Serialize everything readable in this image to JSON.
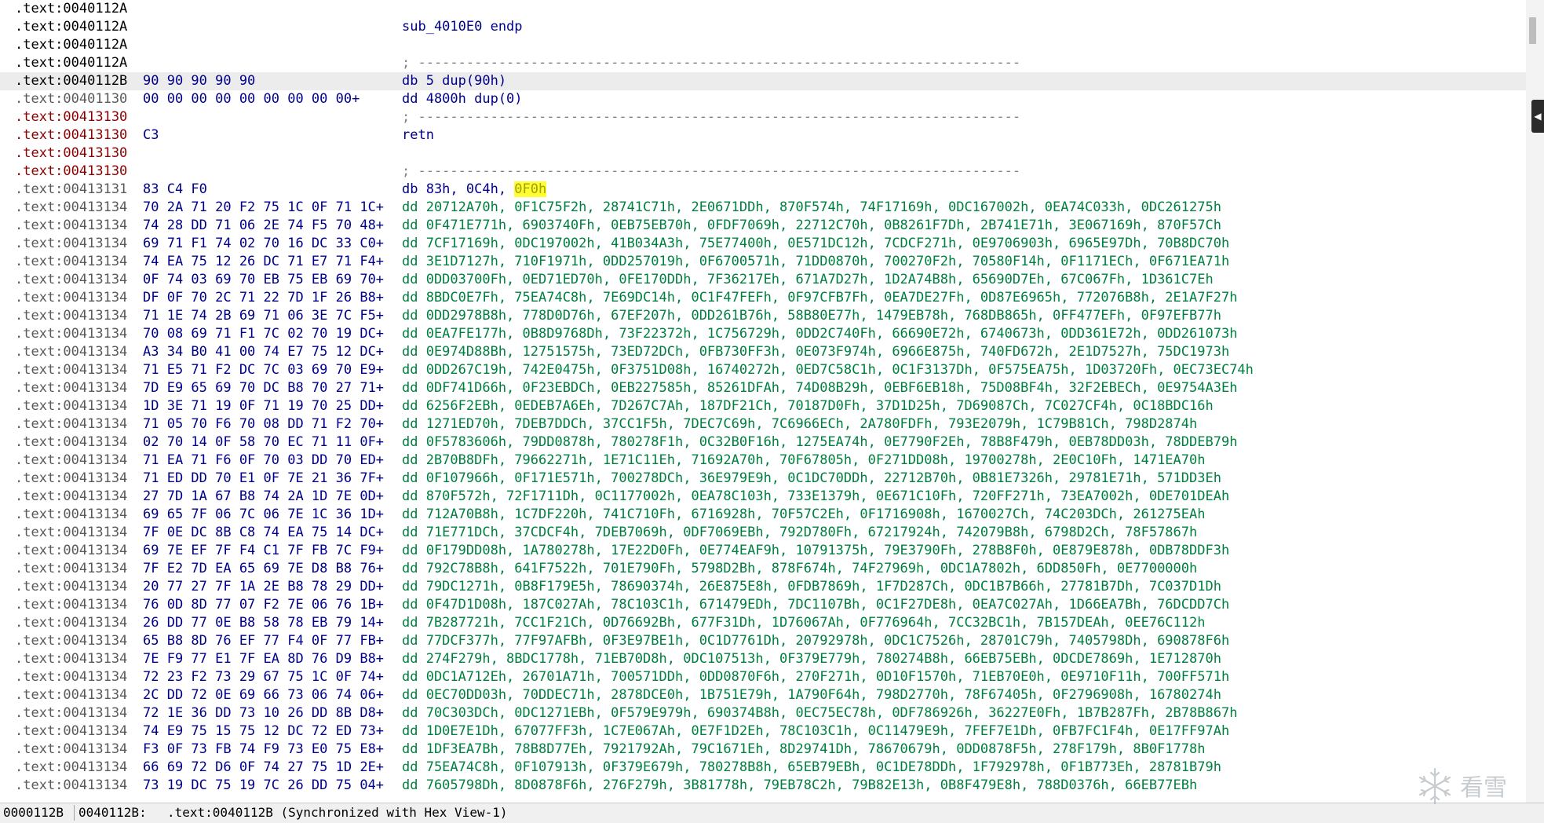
{
  "disassembly": {
    "lines": [
      {
        "addr": ".text:0040112A",
        "addr_style": "black",
        "bytes": "",
        "code": "",
        "code_style": ""
      },
      {
        "addr": ".text:0040112A",
        "addr_style": "black",
        "bytes": "",
        "code": "sub_4010E0 endp",
        "code_style": ""
      },
      {
        "addr": ".text:0040112A",
        "addr_style": "black",
        "bytes": "",
        "code": "",
        "code_style": ""
      },
      {
        "addr": ".text:0040112A",
        "addr_style": "black",
        "bytes": "",
        "code": "; ---------------------------------------------------------------------------",
        "code_style": "sep"
      },
      {
        "addr": ".text:0040112B",
        "addr_style": "black",
        "bytes": "90 90 90 90 90",
        "code": "db 5 dup(90h)",
        "code_style": "",
        "highlight": true
      },
      {
        "addr": ".text:00401130",
        "addr_style": "gray",
        "bytes": "00 00 00 00 00 00 00 00 00+",
        "code": "dd 4800h dup(0)",
        "code_style": ""
      },
      {
        "addr": ".text:00413130",
        "addr_style": "red",
        "bytes": "",
        "code": "; ---------------------------------------------------------------------------",
        "code_style": "sep"
      },
      {
        "addr": ".text:00413130",
        "addr_style": "red",
        "bytes": "C3",
        "code": "retn",
        "code_style": ""
      },
      {
        "addr": ".text:00413130",
        "addr_style": "red",
        "bytes": "",
        "code": "",
        "code_style": ""
      },
      {
        "addr": ".text:00413130",
        "addr_style": "red",
        "bytes": "",
        "code": "; ---------------------------------------------------------------------------",
        "code_style": "sep"
      },
      {
        "addr": ".text:00413131",
        "addr_style": "gray",
        "bytes": "83 C4 F0",
        "code": "db 83h, 0C4h, ",
        "code_style": "",
        "code_hl": "0F0h"
      },
      {
        "addr": ".text:00413134",
        "addr_style": "gray",
        "bytes": "70 2A 71 20 F2 75 1C 0F 71 1C+",
        "code": "dd 20712A70h, 0F1C75F2h, 28741C71h, 2E0671DDh, 870F574h, 74F17169h, 0DC167002h, 0EA74C033h, 0DC261275h",
        "code_style": "data"
      },
      {
        "addr": ".text:00413134",
        "addr_style": "gray",
        "bytes": "74 28 DD 71 06 2E 74 F5 70 48+",
        "code": "dd 0F471E771h, 6903740Fh, 0EB75EB70h, 0FDF7069h, 22712C70h, 0B8261F7Dh, 2B741E71h, 3E067169h, 870F57Ch",
        "code_style": "data"
      },
      {
        "addr": ".text:00413134",
        "addr_style": "gray",
        "bytes": "69 71 F1 74 02 70 16 DC 33 C0+",
        "code": "dd 7CF17169h, 0DC197002h, 41B034A3h, 75E77400h, 0E571DC12h, 7CDCF271h, 0E9706903h, 6965E97Dh, 70B8DC70h",
        "code_style": "data"
      },
      {
        "addr": ".text:00413134",
        "addr_style": "gray",
        "bytes": "74 EA 75 12 26 DC 71 E7 71 F4+",
        "code": "dd 3E1D7127h, 710F1971h, 0DD257019h, 0F6700571h, 71DD0870h, 700270F2h, 70580F14h, 0F1171ECh, 0F671EA71h",
        "code_style": "data"
      },
      {
        "addr": ".text:00413134",
        "addr_style": "gray",
        "bytes": "0F 74 03 69 70 EB 75 EB 69 70+",
        "code": "dd 0DD03700Fh, 0ED71ED70h, 0FE170DDh, 7F36217Eh, 671A7D27h, 1D2A74B8h, 65690D7Eh, 67C067Fh, 1D361C7Eh",
        "code_style": "data"
      },
      {
        "addr": ".text:00413134",
        "addr_style": "gray",
        "bytes": "DF 0F 70 2C 71 22 7D 1F 26 B8+",
        "code": "dd 8BDC0E7Fh, 75EA74C8h, 7E69DC14h, 0C1F47FEFh, 0F97CFB7Fh, 0EA7DE27Fh, 0D87E6965h, 772076B8h, 2E1A7F27h",
        "code_style": "data"
      },
      {
        "addr": ".text:00413134",
        "addr_style": "gray",
        "bytes": "71 1E 74 2B 69 71 06 3E 7C F5+",
        "code": "dd 0DD2978B8h, 778D0D76h, 67EF207h, 0DD261B76h, 58B80E77h, 1479EB78h, 768DB865h, 0FF477EFh, 0F97EFB77h",
        "code_style": "data"
      },
      {
        "addr": ".text:00413134",
        "addr_style": "gray",
        "bytes": "70 08 69 71 F1 7C 02 70 19 DC+",
        "code": "dd 0EA7FE177h, 0B8D9768Dh, 73F22372h, 1C756729h, 0DD2C740Fh, 66690E72h, 6740673h, 0DD361E72h, 0DD261073h",
        "code_style": "data"
      },
      {
        "addr": ".text:00413134",
        "addr_style": "gray",
        "bytes": "A3 34 B0 41 00 74 E7 75 12 DC+",
        "code": "dd 0E974D88Bh, 12751575h, 73ED72DCh, 0FB730FF3h, 0E073F974h, 6966E875h, 740FD672h, 2E1D7527h, 75DC1973h",
        "code_style": "data"
      },
      {
        "addr": ".text:00413134",
        "addr_style": "gray",
        "bytes": "71 E5 71 F2 DC 7C 03 69 70 E9+",
        "code": "dd 0DD267C19h, 742E0475h, 0F3751D08h, 16740272h, 0ED7C58C1h, 0C1F3137Dh, 0F575EA75h, 1D03720Fh, 0EC73EC74h",
        "code_style": "data"
      },
      {
        "addr": ".text:00413134",
        "addr_style": "gray",
        "bytes": "7D E9 65 69 70 DC B8 70 27 71+",
        "code": "dd 0DF741D66h, 0F23EBDCh, 0EB227585h, 85261DFAh, 74D08B29h, 0EBF6EB18h, 75D08BF4h, 32F2EBECh, 0E9754A3Eh",
        "code_style": "data"
      },
      {
        "addr": ".text:00413134",
        "addr_style": "gray",
        "bytes": "1D 3E 71 19 0F 71 19 70 25 DD+",
        "code": "dd 6256F2EBh, 0EDEB7A6Eh, 7D267C7Ah, 187DF21Ch, 70187D0Fh, 37D1D25h, 7D69087Ch, 7C027CF4h, 0C18BDC16h",
        "code_style": "data"
      },
      {
        "addr": ".text:00413134",
        "addr_style": "gray",
        "bytes": "71 05 70 F6 70 08 DD 71 F2 70+",
        "code": "dd 1271ED70h, 7DEB7DDCh, 37CC1F5h, 7DEC7C69h, 7C6966ECh, 2A780FDFh, 793E2079h, 1C79B81Ch, 798D2874h",
        "code_style": "data"
      },
      {
        "addr": ".text:00413134",
        "addr_style": "gray",
        "bytes": "02 70 14 0F 58 70 EC 71 11 0F+",
        "code": "dd 0F5783606h, 79DD0878h, 780278F1h, 0C32B0F16h, 1275EA74h, 0E7790F2Eh, 78B8F479h, 0EB78DD03h, 78DDEB79h",
        "code_style": "data"
      },
      {
        "addr": ".text:00413134",
        "addr_style": "gray",
        "bytes": "71 EA 71 F6 0F 70 03 DD 70 ED+",
        "code": "dd 2B70B8DFh, 79662271h, 1E71C11Eh, 71692A70h, 70F67805h, 0F271DD08h, 19700278h, 2E0C10Fh, 1471EA70h",
        "code_style": "data"
      },
      {
        "addr": ".text:00413134",
        "addr_style": "gray",
        "bytes": "71 ED DD 70 E1 0F 7E 21 36 7F+",
        "code": "dd 0F107966h, 0F171E571h, 700278DCh, 36E979E9h, 0C1DC70DDh, 22712B70h, 0B81E7326h, 29781E71h, 571DD3Eh",
        "code_style": "data"
      },
      {
        "addr": ".text:00413134",
        "addr_style": "gray",
        "bytes": "27 7D 1A 67 B8 74 2A 1D 7E 0D+",
        "code": "dd 870F572h, 72F1711Dh, 0C1177002h, 0EA78C103h, 733E1379h, 0E671C10Fh, 720FF271h, 73EA7002h, 0DE701DEAh",
        "code_style": "data"
      },
      {
        "addr": ".text:00413134",
        "addr_style": "gray",
        "bytes": "69 65 7F 06 7C 06 7E 1C 36 1D+",
        "code": "dd 712A70B8h, 1C7DF220h, 741C710Fh, 6716928h, 70F57C2Eh, 0F1716908h, 1670027Ch, 74C203DCh, 261275EAh",
        "code_style": "data"
      },
      {
        "addr": ".text:00413134",
        "addr_style": "gray",
        "bytes": "7F 0E DC 8B C8 74 EA 75 14 DC+",
        "code": "dd 71E771DCh, 37CDCF4h, 7DEB7069h, 0DF7069EBh, 792D780Fh, 67217924h, 742079B8h, 6798D2Ch, 78F57867h",
        "code_style": "data"
      },
      {
        "addr": ".text:00413134",
        "addr_style": "gray",
        "bytes": "69 7E EF 7F F4 C1 7F FB 7C F9+",
        "code": "dd 0F179DD08h, 1A780278h, 17E22D0Fh, 0E774EAF9h, 10791375h, 79E3790Fh, 278B8F0h, 0E879E878h, 0DB78DDF3h",
        "code_style": "data"
      },
      {
        "addr": ".text:00413134",
        "addr_style": "gray",
        "bytes": "7F E2 7D EA 65 69 7E D8 B8 76+",
        "code": "dd 792C78B8h, 641F7522h, 701E790Fh, 5798D2Bh, 878F674h, 74F27969h, 0DC1A7802h, 6DD850Fh, 0E7700000h",
        "code_style": "data"
      },
      {
        "addr": ".text:00413134",
        "addr_style": "gray",
        "bytes": "20 77 27 7F 1A 2E B8 78 29 DD+",
        "code": "dd 79DC1271h, 0B8F179E5h, 78690374h, 26E875E8h, 0FDB7869h, 1F7D287Ch, 0DC1B7B66h, 27781B7Dh, 7C037D1Dh",
        "code_style": "data"
      },
      {
        "addr": ".text:00413134",
        "addr_style": "gray",
        "bytes": "76 0D 8D 77 07 F2 7E 06 76 1B+",
        "code": "dd 0F47D1D08h, 187C027Ah, 78C103C1h, 671479EDh, 7DC1107Bh, 0C1F27DE8h, 0EA7C027Ah, 1D66EA7Bh, 76DCDD7Ch",
        "code_style": "data"
      },
      {
        "addr": ".text:00413134",
        "addr_style": "gray",
        "bytes": "26 DD 77 0E B8 58 78 EB 79 14+",
        "code": "dd 7B287721h, 7CC1F21Ch, 0D76692Bh, 677F31Dh, 1D76067Ah, 0F776964h, 7CC32BC1h, 7B157DEAh, 0EE76C112h",
        "code_style": "data"
      },
      {
        "addr": ".text:00413134",
        "addr_style": "gray",
        "bytes": "65 B8 8D 76 EF 77 F4 0F 77 FB+",
        "code": "dd 77DCF377h, 77F97AFBh, 0F3E97BE1h, 0C1D7761Dh, 20792978h, 0DC1C7526h, 28701C79h, 7405798Dh, 690878F6h",
        "code_style": "data"
      },
      {
        "addr": ".text:00413134",
        "addr_style": "gray",
        "bytes": "7E F9 77 E1 7F EA 8D 76 D9 B8+",
        "code": "dd 274F279h, 8BDC1778h, 71EB70D8h, 0DC107513h, 0F379E779h, 780274B8h, 66EB75EBh, 0DCDE7869h, 1E712870h",
        "code_style": "data"
      },
      {
        "addr": ".text:00413134",
        "addr_style": "gray",
        "bytes": "72 23 F2 73 29 67 75 1C 0F 74+",
        "code": "dd 0DC1A712Eh, 26701A71h, 700571DDh, 0DD0870F6h, 270F271h, 0D10F1570h, 71EB70E0h, 0E9710F11h, 700FF571h",
        "code_style": "data"
      },
      {
        "addr": ".text:00413134",
        "addr_style": "gray",
        "bytes": "2C DD 72 0E 69 66 73 06 74 06+",
        "code": "dd 0EC70DD03h, 70DDEC71h, 2878DCE0h, 1B751E79h, 1A790F64h, 798D2770h, 78F67405h, 0F2796908h, 16780274h",
        "code_style": "data"
      },
      {
        "addr": ".text:00413134",
        "addr_style": "gray",
        "bytes": "72 1E 36 DD 73 10 26 DD 8B D8+",
        "code": "dd 70C303DCh, 0DC1271EBh, 0F579E979h, 690374B8h, 0EC75EC78h, 0DF786926h, 36227E0Fh, 1B7B287Fh, 2B78B867h",
        "code_style": "data"
      },
      {
        "addr": ".text:00413134",
        "addr_style": "gray",
        "bytes": "74 E9 75 15 75 12 DC 72 ED 73+",
        "code": "dd 1D0E7E1Dh, 67077FF3h, 1C7E067Ah, 0E7F1D2Eh, 78C103C1h, 0C11479E9h, 7FEF7E1Dh, 0FB7FC1F4h, 0E17FF97Ah",
        "code_style": "data"
      },
      {
        "addr": ".text:00413134",
        "addr_style": "gray",
        "bytes": "F3 0F 73 FB 74 F9 73 E0 75 E8+",
        "code": "dd 1DF3EA7Bh, 78B8D77Eh, 7921792Ah, 79C1671Eh, 8D29741Dh, 78670679h, 0DD0878F5h, 278F179h, 8B0F1778h",
        "code_style": "data"
      },
      {
        "addr": ".text:00413134",
        "addr_style": "gray",
        "bytes": "66 69 72 D6 0F 74 27 75 1D 2E+",
        "code": "dd 75EA74C8h, 0F107913h, 0F379E679h, 780278B8h, 65EB79EBh, 0C1DE78DDh, 1F792978h, 0F1B773Eh, 28781B79h",
        "code_style": "data"
      },
      {
        "addr": ".text:00413134",
        "addr_style": "gray",
        "bytes": "73 19 DC 75 19 7C 26 DD 75 04+",
        "code": "dd 7605798Dh, 8D0878F6h, 276F279h, 3B81778h, 79EB78C2h, 79B82E13h, 0B8F479E8h, 788D0376h, 66EB77EBh",
        "code_style": "data"
      }
    ]
  },
  "statusbar": {
    "offset": "0000112B",
    "address": "0040112B:",
    "label": ".text:0040112B (Synchronized with Hex View-1)"
  },
  "watermark": {
    "text": "看雪"
  },
  "icons": {
    "collapse": "collapse-arrow-icon",
    "logo": "snowflake-logo-icon"
  }
}
